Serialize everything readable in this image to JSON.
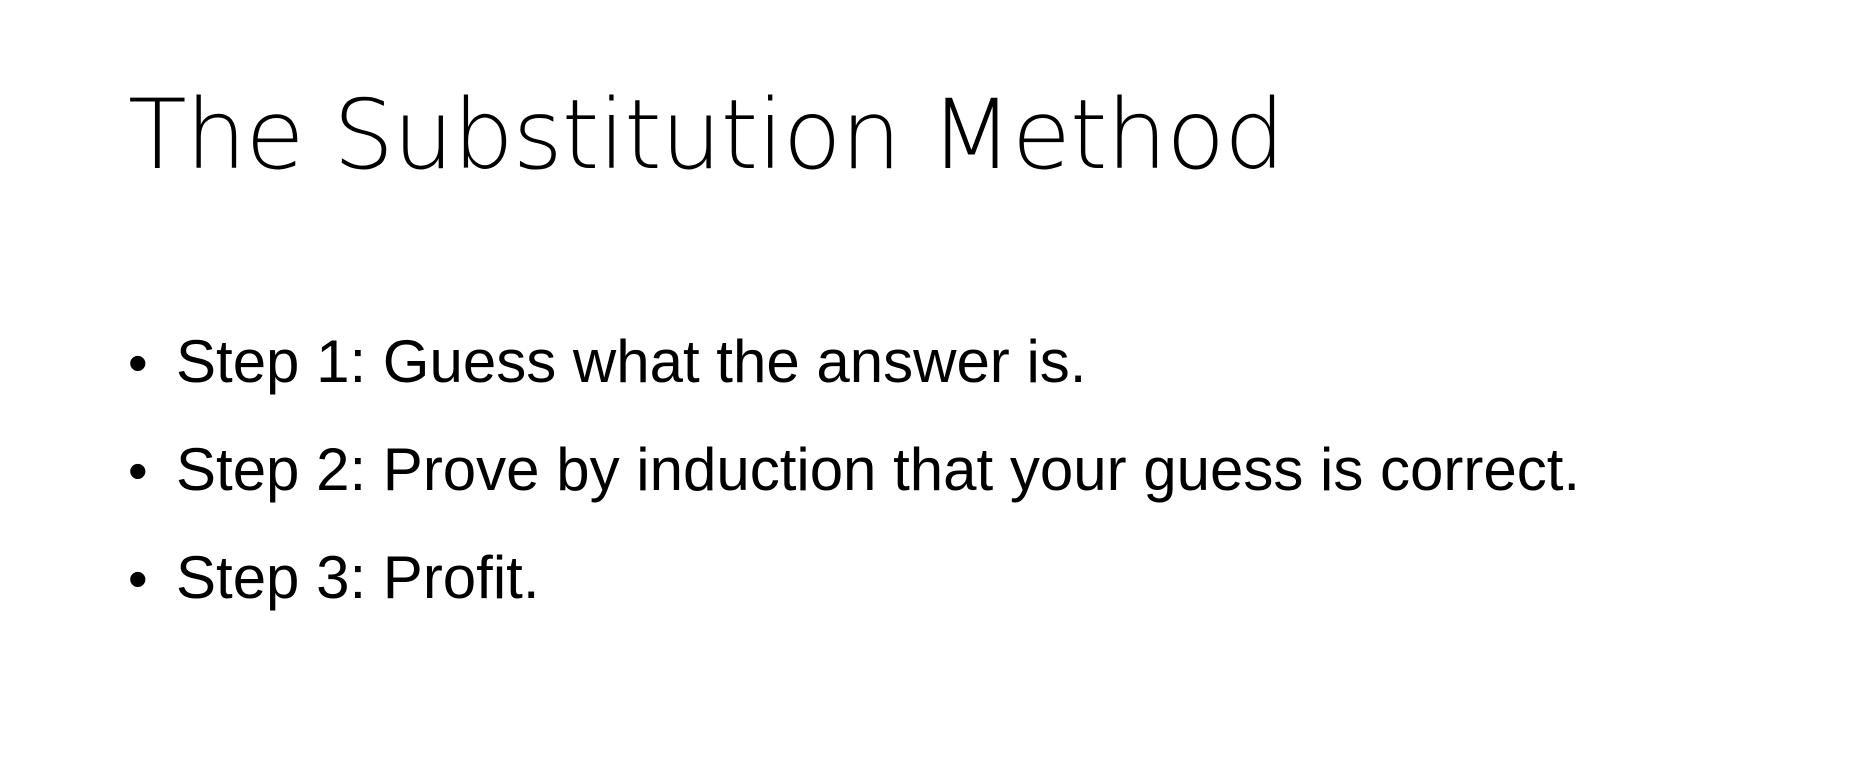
{
  "slide": {
    "title": "The Substitution Method",
    "bullets": [
      {
        "marker": "•",
        "text": "Step 1: Guess what the answer is."
      },
      {
        "marker": "•",
        "text": "Step 2: Prove by induction that your guess is correct."
      },
      {
        "marker": "•",
        "text": "Step 3: Profit."
      }
    ]
  }
}
